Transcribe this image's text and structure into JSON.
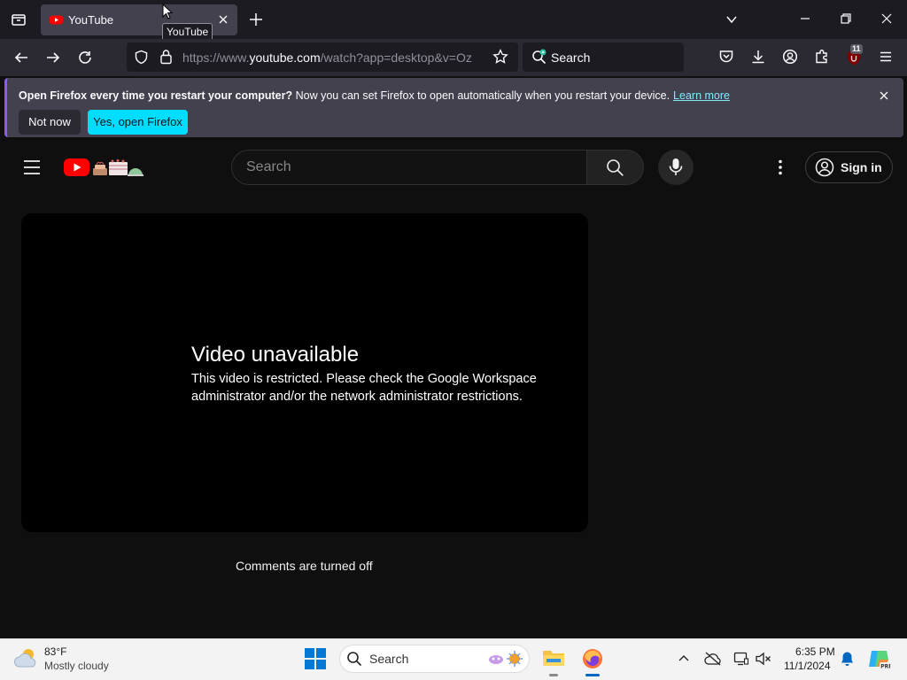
{
  "browser": {
    "tab_title": "YouTube",
    "tooltip": "YouTube",
    "url_prefix": "https://www.",
    "url_host": "youtube.com",
    "url_rest": "/watch?app=desktop&v=Oz",
    "search_label": "Search",
    "extension_badge": "11",
    "accent": "#9059ff"
  },
  "notification": {
    "bold": "Open Firefox every time you restart your computer?",
    "text": "Now you can set Firefox to open automatically when you restart your device.",
    "link": "Learn more",
    "not_now": "Not now",
    "yes": "Yes, open Firefox"
  },
  "youtube": {
    "search_placeholder": "Search",
    "sign_in": "Sign in",
    "error_title": "Video unavailable",
    "error_message": "This video is restricted. Please check the Google Workspace administrator and/or the network administrator restrictions.",
    "comments_off": "Comments are turned off"
  },
  "taskbar": {
    "temperature": "83°F",
    "weather": "Mostly cloudy",
    "search_label": "Search",
    "time": "6:35 PM",
    "date": "11/1/2024"
  }
}
